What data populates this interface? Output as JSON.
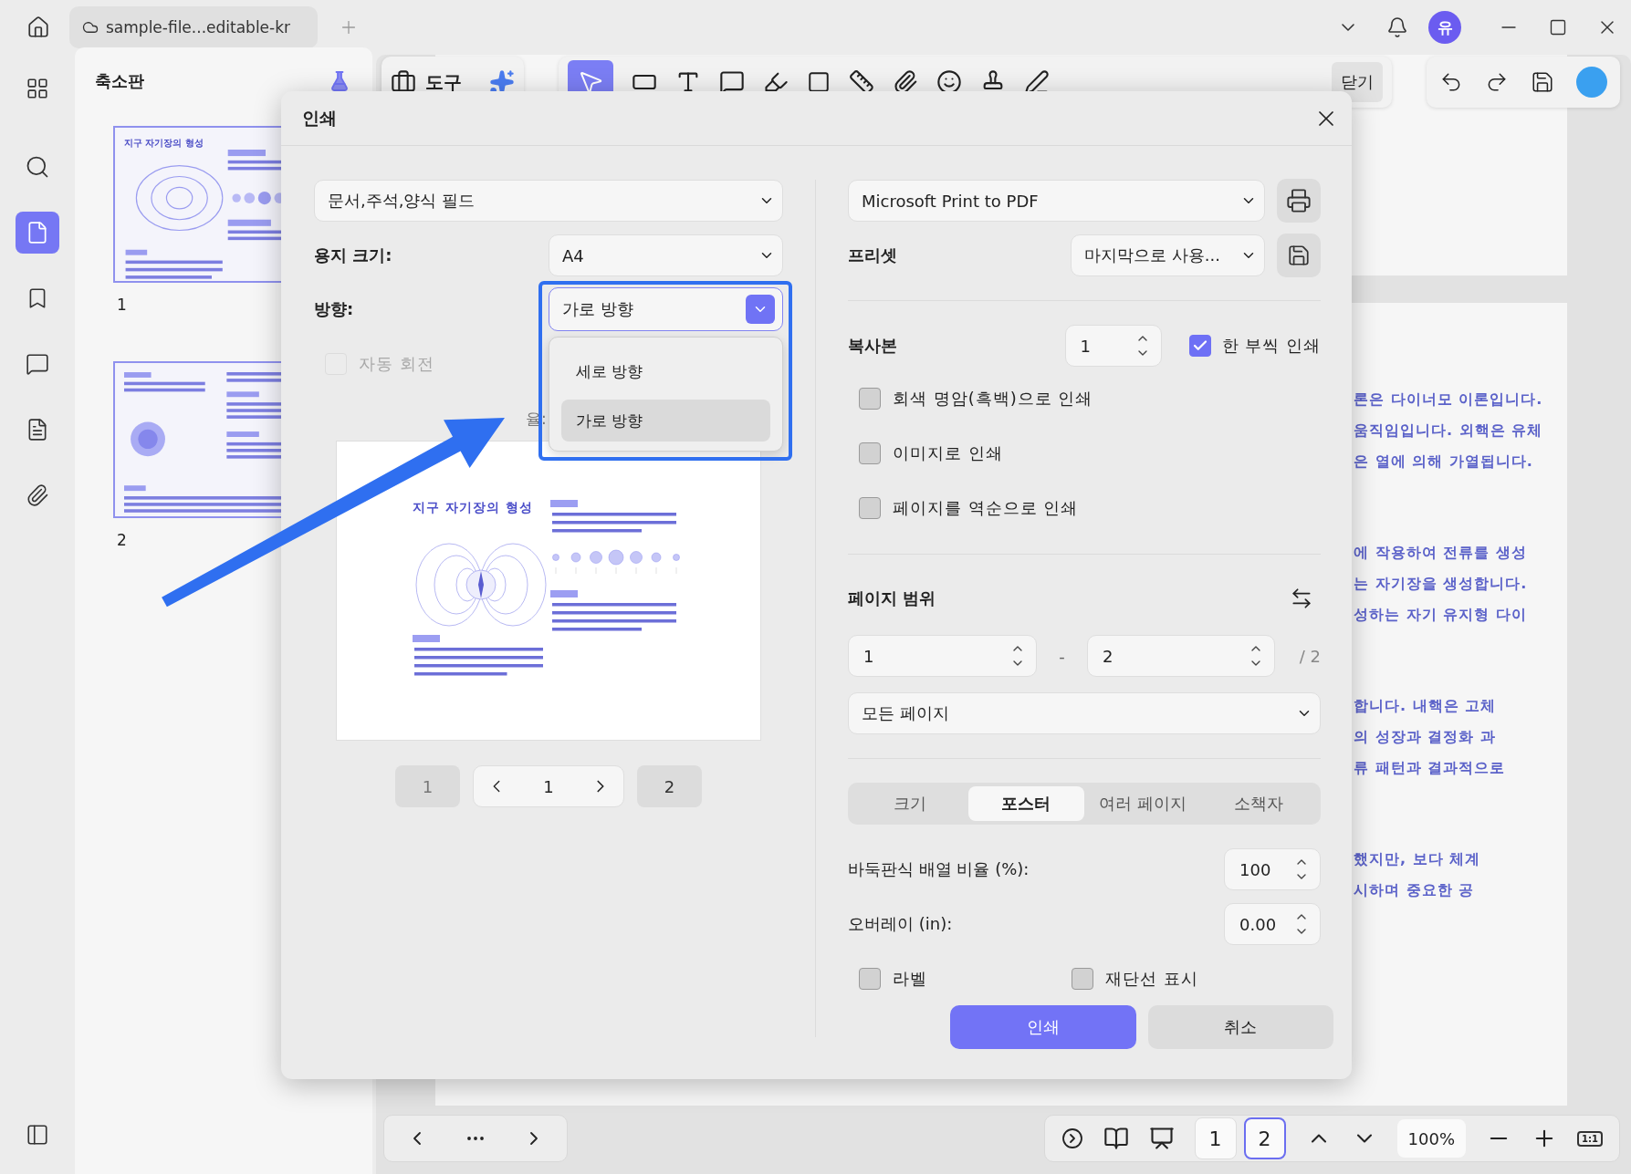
{
  "titlebar": {
    "tab_title": "sample-file...editable-kr",
    "avatar": "유"
  },
  "sidebar": {
    "title": "축소판",
    "thumbnails": [
      {
        "page": "1",
        "title": "지구 자기장의 형성"
      },
      {
        "page": "2"
      }
    ]
  },
  "toolbar": {
    "tools_label": "도구",
    "close_label": "닫기"
  },
  "document": {
    "paragraphs": [
      [
        "론은 다이너모 이론입니다.",
        "움직임입니다. 외핵은 유체",
        "은 열에 의해 가열됩니다."
      ],
      [
        "에 작용하여 전류를 생성",
        "는 자기장을 생성합니다.",
        "성하는 자기 유지형 다이"
      ],
      [
        "합니다. 내핵은 고체",
        "의 성장과 결정화 과",
        "류 패턴과 결과적으로"
      ],
      [
        "했지만, 보다 체계",
        "시하며 중요한 공"
      ]
    ]
  },
  "bottom_bar": {
    "pages": [
      {
        "label": "1",
        "selected": false
      },
      {
        "label": "2",
        "selected": true
      }
    ],
    "zoom": "100%",
    "actual_size": "1:1"
  },
  "dialog": {
    "title": "인쇄",
    "content_select": "문서,주석,양식 필드",
    "paper_size": {
      "label": "용지 크기:",
      "value": "A4"
    },
    "orientation": {
      "label": "방향:",
      "value": "가로 방향",
      "expanded": true,
      "options": [
        {
          "label": "세로 방향",
          "selected": false
        },
        {
          "label": "가로 방향",
          "selected": true
        }
      ]
    },
    "auto_rotate": {
      "label": "자동 회전",
      "checked": false,
      "disabled": true
    },
    "scale_label": "율:",
    "preview": {
      "title": "지구 자기장의 형성"
    },
    "preview_nav": {
      "first": "1",
      "current": "1",
      "last": "2"
    },
    "printer": "Microsoft Print to PDF",
    "preset": {
      "label": "프리셋",
      "value": "마지막으로 사용..."
    },
    "copies": {
      "label": "복사본",
      "value": "1",
      "collate": {
        "label": "한 부씩 인쇄",
        "checked": true
      }
    },
    "options": [
      {
        "label": "회색 명암(흑백)으로 인쇄",
        "checked": false
      },
      {
        "label": "이미지로 인쇄",
        "checked": false
      },
      {
        "label": "페이지를 역순으로 인쇄",
        "checked": false
      }
    ],
    "page_range": {
      "label": "페이지 범위",
      "from": "1",
      "separator": "-",
      "to": "2",
      "total": "/ 2",
      "subset": "모든 페이지"
    },
    "mode_tabs": [
      {
        "label": "크기",
        "selected": false
      },
      {
        "label": "포스터",
        "selected": true
      },
      {
        "label": "여러 페이지",
        "selected": false
      },
      {
        "label": "소책자",
        "selected": false
      }
    ],
    "tile_scale": {
      "label": "바둑판식 배열 비율 (%):",
      "value": "100"
    },
    "overlap": {
      "label": "오버레이 (in):",
      "value": "0.00"
    },
    "poster_options": [
      {
        "label": "라벨",
        "checked": false
      },
      {
        "label": "재단선 표시",
        "checked": false
      }
    ],
    "buttons": [
      {
        "label": "인쇄",
        "kind": "primary"
      },
      {
        "label": "취소",
        "kind": "secondary"
      }
    ]
  }
}
